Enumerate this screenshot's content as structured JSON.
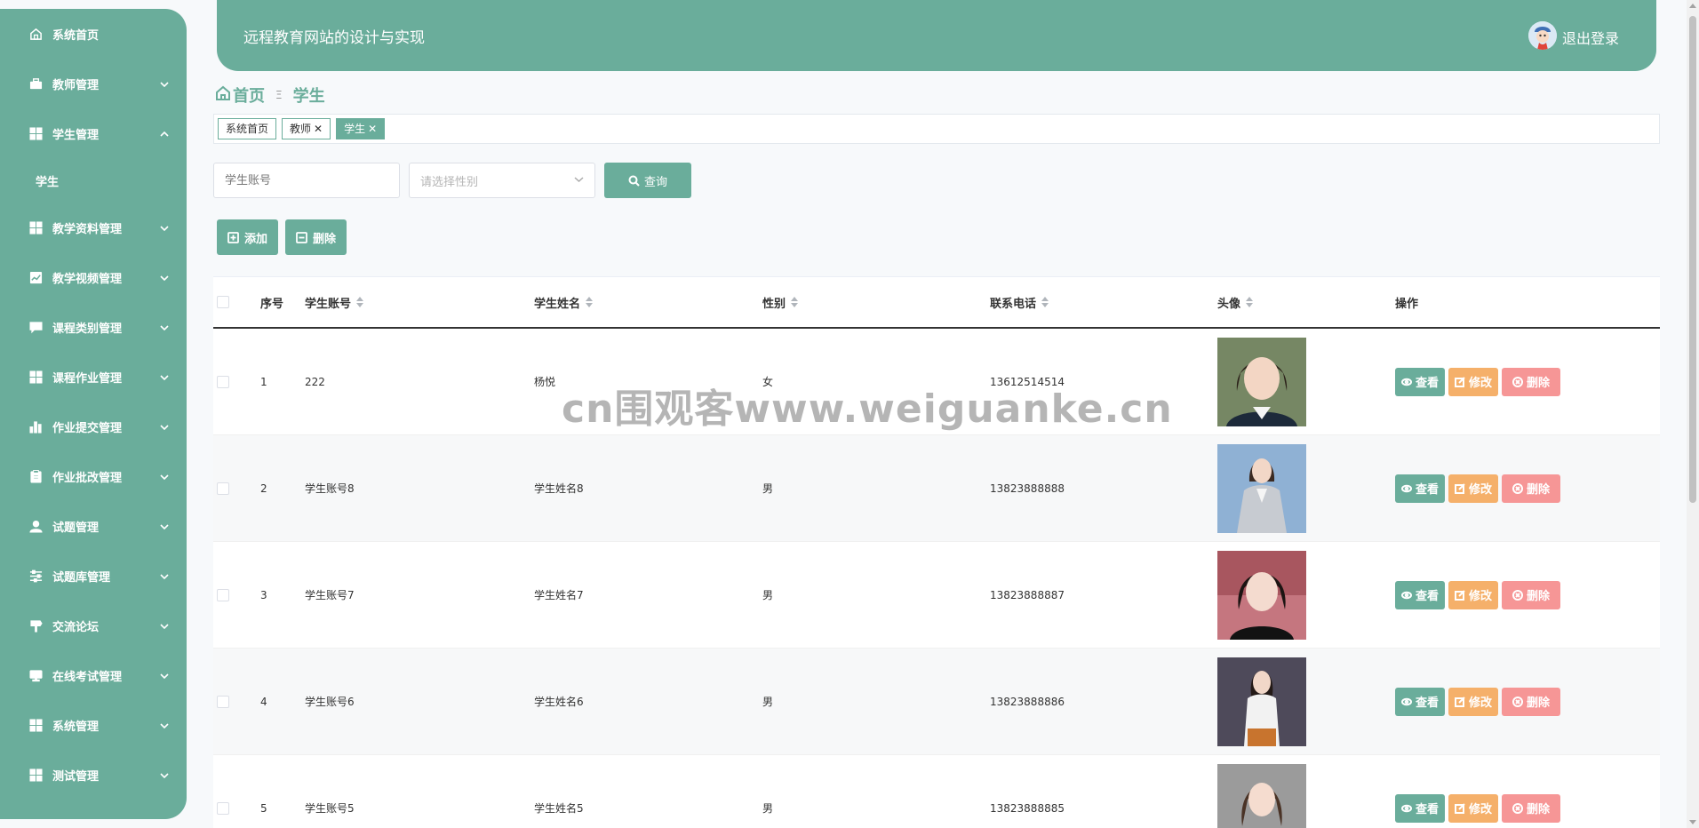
{
  "sidebar": {
    "items": [
      {
        "label": "系统首页",
        "icon": "home-icon",
        "has_chevron": false
      },
      {
        "label": "教师管理",
        "icon": "briefcase-icon",
        "has_chevron": true
      },
      {
        "label": "学生管理",
        "icon": "grid-icon",
        "has_chevron": true,
        "expanded": true
      },
      {
        "label": "教学资料管理",
        "icon": "grid-icon",
        "has_chevron": true
      },
      {
        "label": "教学视频管理",
        "icon": "chart-line-icon",
        "has_chevron": true
      },
      {
        "label": "课程类别管理",
        "icon": "chat-icon",
        "has_chevron": true
      },
      {
        "label": "课程作业管理",
        "icon": "grid-icon",
        "has_chevron": true
      },
      {
        "label": "作业提交管理",
        "icon": "bar-chart-icon",
        "has_chevron": true
      },
      {
        "label": "作业批改管理",
        "icon": "clipboard-icon",
        "has_chevron": true
      },
      {
        "label": "试题管理",
        "icon": "user-icon",
        "has_chevron": true
      },
      {
        "label": "试题库管理",
        "icon": "sliders-icon",
        "has_chevron": true
      },
      {
        "label": "交流论坛",
        "icon": "signpost-icon",
        "has_chevron": true
      },
      {
        "label": "在线考试管理",
        "icon": "monitor-icon",
        "has_chevron": true
      },
      {
        "label": "系统管理",
        "icon": "grid-icon",
        "has_chevron": true
      },
      {
        "label": "测试管理",
        "icon": "grid-icon",
        "has_chevron": true
      }
    ],
    "sub_item": "学生"
  },
  "header": {
    "title": "远程教育网站的设计与实现",
    "logout": "退出登录"
  },
  "breadcrumb": {
    "home": "首页",
    "separator": "Ξ",
    "current": "学生"
  },
  "tags": [
    {
      "label": "系统首页",
      "closable": false,
      "active": false
    },
    {
      "label": "教师",
      "closable": true,
      "active": false
    },
    {
      "label": "学生",
      "closable": true,
      "active": true
    }
  ],
  "search": {
    "account_placeholder": "学生账号",
    "gender_placeholder": "请选择性别",
    "query_label": "查询"
  },
  "actions": {
    "add_label": "添加",
    "delete_label": "删除"
  },
  "table": {
    "headers": {
      "index": "序号",
      "account": "学生账号",
      "name": "学生姓名",
      "gender": "性别",
      "phone": "联系电话",
      "avatar": "头像",
      "ops": "操作"
    },
    "op_labels": {
      "view": "查看",
      "edit": "修改",
      "delete": "删除"
    },
    "rows": [
      {
        "index": "1",
        "account": "222",
        "name": "杨悦",
        "gender": "女",
        "phone": "13612514514"
      },
      {
        "index": "2",
        "account": "学生账号8",
        "name": "学生姓名8",
        "gender": "男",
        "phone": "13823888888"
      },
      {
        "index": "3",
        "account": "学生账号7",
        "name": "学生姓名7",
        "gender": "男",
        "phone": "13823888887"
      },
      {
        "index": "4",
        "account": "学生账号6",
        "name": "学生姓名6",
        "gender": "男",
        "phone": "13823888886"
      },
      {
        "index": "5",
        "account": "学生账号5",
        "name": "学生姓名5",
        "gender": "男",
        "phone": "13823888885"
      }
    ]
  },
  "watermark": "cn围观客www.weiguanke.cn",
  "colors": {
    "primary": "#6aad9b",
    "edit": "#f5b06a",
    "delete": "#f69696"
  }
}
